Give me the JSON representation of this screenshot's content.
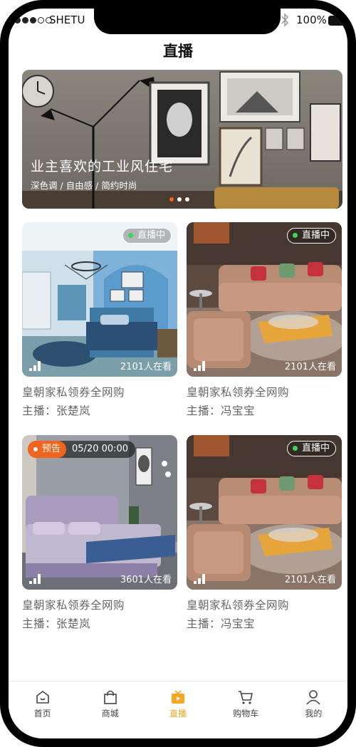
{
  "status_bar": {
    "carrier": "SHETU",
    "battery": "100%"
  },
  "page_title": "直播",
  "banner": {
    "title": "业主喜欢的工业风住宅",
    "tags": "深色调 / 自由感 / 简约时尚",
    "active_dot": 0,
    "dot_count": 3
  },
  "cards": [
    {
      "badge": "直播中",
      "viewers": "2101人在看",
      "title": "皇朝家私领券全网购",
      "host": "主播：张楚岚"
    },
    {
      "badge": "直播中",
      "viewers": "2101人在看",
      "title": "皇朝家私领券全网购",
      "host": "主播：冯宝宝"
    },
    {
      "badge": "预告",
      "time": "05/20 00:00",
      "viewers": "3601人在看",
      "title": "皇朝家私领券全网购",
      "host": "主播：张楚岚"
    },
    {
      "badge": "直播中",
      "viewers": "2101人在看",
      "title": "皇朝家私领券全网购",
      "host": "主播：冯宝宝"
    }
  ],
  "tabs": [
    {
      "label": "首页",
      "icon": "home-icon"
    },
    {
      "label": "商城",
      "icon": "shopping-bag-icon"
    },
    {
      "label": "直播",
      "icon": "tv-icon",
      "active": true
    },
    {
      "label": "购物车",
      "icon": "cart-icon"
    },
    {
      "label": "我的",
      "icon": "user-icon"
    }
  ],
  "colors": {
    "accent": "#f0641e",
    "tab_active": "#f5a623",
    "live": "#3fd45a"
  }
}
